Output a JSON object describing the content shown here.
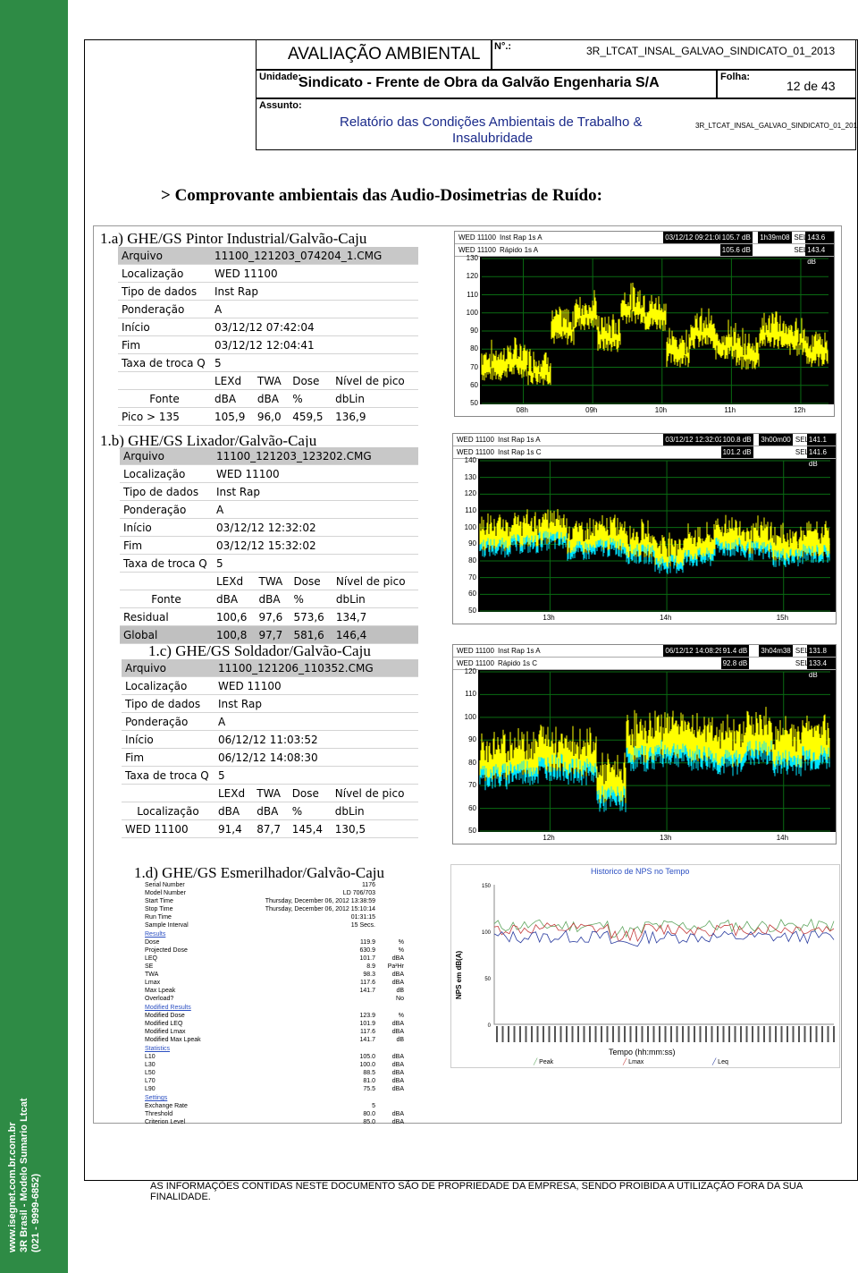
{
  "sidebar": {
    "lines": [
      "www.isegnet.com.br.com.br",
      "3R Brasil - Modelo Sumario Ltcat",
      "(021 - 9999-6852)"
    ]
  },
  "header": {
    "title": "AVALIAÇÃO AMBIENTAL",
    "no_label": "N°.:",
    "doc_code": "3R_LTCAT_INSAL_GALVAO_SINDICATO_01_2013",
    "unidade_label": "Unidade:",
    "unidade_value": "Sindicato - Frente de Obra da Galvão Engenharia S/A",
    "folha_label": "Folha:",
    "folha_value": "12 de 43",
    "assunto_label": "Assunto:",
    "assunto_value_1": "Relatório das Condições Ambientais de Trabalho &",
    "assunto_value_2": "Insalubridade",
    "doc_code_small": "3R_LTCAT_INSAL_GALVAO_SINDICATO_01_2013"
  },
  "section_title": "> Comprovante ambientais das Audio-Dosimetrias de Ruído:",
  "block_a": {
    "title": "1.a) GHE/GS Pintor Industrial/Galvão-Caju",
    "rows": [
      [
        "Arquivo",
        "11100_121203_074204_1.CMG"
      ],
      [
        "Localização",
        "WED 11100"
      ],
      [
        "Tipo de dados",
        "Inst Rap"
      ],
      [
        "Ponderação",
        "A"
      ],
      [
        "Início",
        "03/12/12 07:42:04"
      ],
      [
        "Fim",
        "03/12/12 12:04:41"
      ],
      [
        "Taxa de troca Q",
        "5"
      ]
    ],
    "head1": [
      "",
      "LEXd",
      "TWA",
      "Dose",
      "Nível de pico"
    ],
    "head2": [
      "Fonte",
      "dBA",
      "dBA",
      "%",
      "dbLin"
    ],
    "data": [
      [
        "Pico > 135",
        "105,9",
        "96,0",
        "459,5",
        "136,9"
      ]
    ],
    "chart": {
      "r1": [
        "WED 11100",
        "Inst Rap 1s  A",
        "03/12/12 09:21:08",
        "105.7 dB",
        "1h39m08",
        "SEL",
        "143.6 dB"
      ],
      "r2": [
        "WED 11100",
        "Rápido 1s  A",
        "",
        "105.6 dB",
        "",
        "SEL",
        "143.4 dB"
      ],
      "y": [
        "130",
        "120",
        "110",
        "100",
        "90",
        "80",
        "70",
        "60",
        "50"
      ],
      "x": [
        "08h",
        "09h",
        "10h",
        "11h",
        "12h"
      ]
    }
  },
  "block_b": {
    "title": "1.b) GHE/GS Lixador/Galvão-Caju",
    "rows": [
      [
        "Arquivo",
        "11100_121203_123202.CMG"
      ],
      [
        "Localização",
        "WED 11100"
      ],
      [
        "Tipo de dados",
        "Inst Rap"
      ],
      [
        "Ponderação",
        "A"
      ],
      [
        "Início",
        "03/12/12 12:32:02"
      ],
      [
        "Fim",
        "03/12/12 15:32:02"
      ],
      [
        "Taxa de troca Q",
        "5"
      ]
    ],
    "head1": [
      "",
      "LEXd",
      "TWA",
      "Dose",
      "Nível de pico"
    ],
    "head2": [
      "Fonte",
      "dBA",
      "dBA",
      "%",
      "dbLin"
    ],
    "data": [
      [
        "Residual",
        "100,6",
        "97,6",
        "573,6",
        "134,7"
      ],
      [
        "Global",
        "100,8",
        "97,7",
        "581,6",
        "146,4"
      ]
    ],
    "chart": {
      "r1": [
        "WED 11100",
        "Inst Rap 1s  A",
        "03/12/12 12:32:02",
        "100.8 dB",
        "3h00m00",
        "SEL",
        "141.1 dB"
      ],
      "r2": [
        "WED 11100",
        "Inst Rap 1s  C",
        "",
        "101.2 dB",
        "",
        "SEL",
        "141.6 dB"
      ],
      "y": [
        "140",
        "130",
        "120",
        "110",
        "100",
        "90",
        "80",
        "70",
        "60",
        "50"
      ],
      "x": [
        "13h",
        "14h",
        "15h"
      ]
    }
  },
  "block_c": {
    "title": "1.c) GHE/GS Soldador/Galvão-Caju",
    "rows": [
      [
        "Arquivo",
        "11100_121206_110352.CMG"
      ],
      [
        "Localização",
        "WED 11100"
      ],
      [
        "Tipo de dados",
        "Inst Rap"
      ],
      [
        "Ponderação",
        "A"
      ],
      [
        "Início",
        "06/12/12 11:03:52"
      ],
      [
        "Fim",
        "06/12/12 14:08:30"
      ],
      [
        "Taxa de troca Q",
        "5"
      ]
    ],
    "head1": [
      "",
      "LEXd",
      "TWA",
      "Dose",
      "Nível de pico"
    ],
    "head2": [
      "Localização",
      "dBA",
      "dBA",
      "%",
      "dbLin"
    ],
    "data": [
      [
        "WED 11100",
        "91,4",
        "87,7",
        "145,4",
        "130,5"
      ]
    ],
    "chart": {
      "r1": [
        "WED 11100",
        "Inst Rap 1s  A",
        "06/12/12 14:08:29",
        "91.4 dB",
        "3h04m38",
        "SEL",
        "131.8 dB"
      ],
      "r2": [
        "WED 11100",
        "Rápido 1s  C",
        "",
        "92.8 dB",
        "",
        "SEL",
        "133.4 dB"
      ],
      "y": [
        "120",
        "110",
        "100",
        "90",
        "80",
        "70",
        "60",
        "50"
      ],
      "x": [
        "12h",
        "13h",
        "14h"
      ]
    }
  },
  "block_d": {
    "title": "1.d) GHE/GS Esmerilhador/Galvão-Caju",
    "summary": [
      {
        "k": "Serial Number",
        "v": "1176",
        "u": ""
      },
      {
        "k": "Model Number",
        "v": "LD 706/703",
        "u": ""
      },
      {
        "k": "Start Time",
        "v": "Thursday, December 06, 2012 13:38:59",
        "u": ""
      },
      {
        "k": "Stop Time",
        "v": "Thursday, December 06, 2012 15:10:14",
        "u": ""
      },
      {
        "k": "Run Time",
        "v": "01:31:15",
        "u": ""
      },
      {
        "k": "Sample Interval",
        "v": "15 Secs.",
        "u": ""
      },
      {
        "sec": "Results"
      },
      {
        "k": "Dose",
        "v": "119.9",
        "u": "%"
      },
      {
        "k": "Projected Dose",
        "v": "630.9",
        "u": "%"
      },
      {
        "k": "LEQ",
        "v": "101.7",
        "u": "dBA"
      },
      {
        "k": "SE",
        "v": "8.9",
        "u": "Pa²Hr"
      },
      {
        "k": "TWA",
        "v": "98.3",
        "u": "dBA"
      },
      {
        "k": "Lmax",
        "v": "117.6",
        "u": "dBA"
      },
      {
        "k": "Max Lpeak",
        "v": "141.7",
        "u": "dB"
      },
      {
        "k": "Overload?",
        "v": "",
        "u": "No"
      },
      {
        "sec": "Modified Results"
      },
      {
        "k": "Modified Dose",
        "v": "123.9",
        "u": "%"
      },
      {
        "k": "Modified LEQ",
        "v": "101.9",
        "u": "dBA"
      },
      {
        "k": "Modified Lmax",
        "v": "117.6",
        "u": "dBA"
      },
      {
        "k": "Modified Max Lpeak",
        "v": "141.7",
        "u": "dB"
      },
      {
        "sec": "Statistics"
      },
      {
        "k": "L10",
        "v": "105.0",
        "u": "dBA"
      },
      {
        "k": "L30",
        "v": "100.0",
        "u": "dBA"
      },
      {
        "k": "L50",
        "v": "88.5",
        "u": "dBA"
      },
      {
        "k": "L70",
        "v": "81.0",
        "u": "dBA"
      },
      {
        "k": "L90",
        "v": "75.5",
        "u": "dBA"
      },
      {
        "sec": "Settings"
      },
      {
        "k": "Exchange Rate",
        "v": "5",
        "u": ""
      },
      {
        "k": "Threshold",
        "v": "80.0",
        "u": "dBA"
      },
      {
        "k": "Criterion Level",
        "v": "85.0",
        "u": "dBA"
      }
    ],
    "chart": {
      "title": "Historico de NPS no Tempo",
      "ylabel": "NPS em dB(A)",
      "xlabel": "Tempo (hh:mm:ss)",
      "y": [
        "150",
        "100",
        "50",
        "0"
      ],
      "legend": [
        "Peak",
        "Lmax",
        "Leq"
      ]
    }
  },
  "footer": "AS INFORMAÇÕES CONTIDAS NESTE DOCUMENTO SÃO DE PROPRIEDADE DA EMPRESA, SENDO PROIBIDA A UTILIZAÇÃO FORA DA SUA FINALIDADE.",
  "colors": {
    "sidebar": "#2e8b45",
    "trace_yellow": "#ffff00",
    "trace_cyan": "#00e5ff",
    "grid_green": "#0a6b12"
  }
}
